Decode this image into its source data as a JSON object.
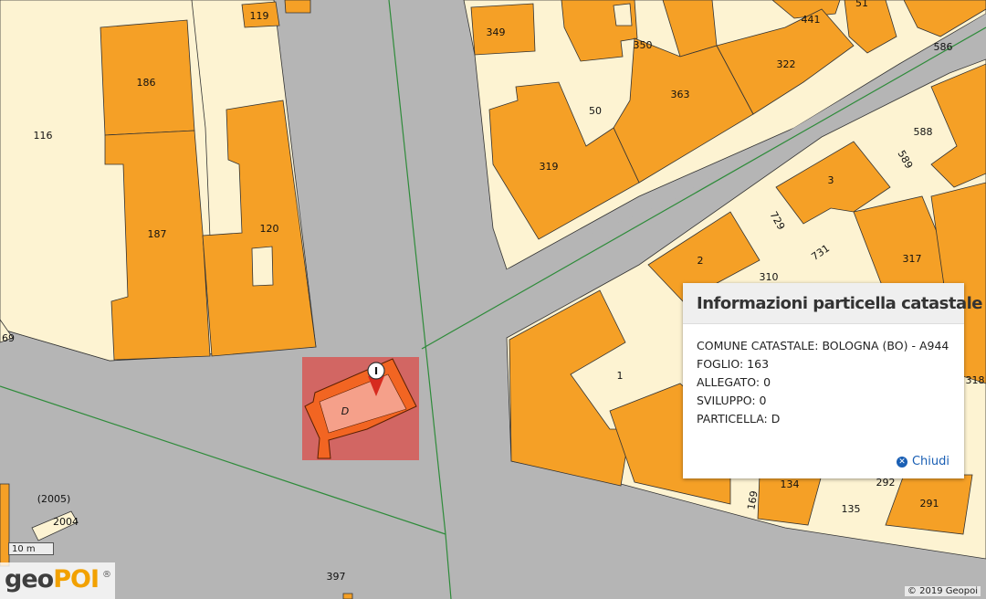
{
  "map": {
    "parcels": [
      "116",
      "119",
      "120",
      "186",
      "187",
      "349",
      "350",
      "441",
      "51",
      "586",
      "322",
      "363",
      "50",
      "319",
      "588",
      "589",
      "3",
      "729",
      "731",
      "317",
      "2",
      "310",
      "1",
      "318",
      "134",
      "292",
      "291",
      "135",
      "169",
      "2004",
      "(2005)",
      "397",
      "69"
    ],
    "selected_parcel_label": "D",
    "marker_glyph": "I"
  },
  "scale": {
    "label": "10 m"
  },
  "logo": {
    "text_left": "geo",
    "text_right": "POI",
    "reg": "®"
  },
  "attribution": {
    "text": "© 2019 Geopoi"
  },
  "popup": {
    "title": "Informazioni particella catastale",
    "lines": [
      "COMUNE CATASTALE: BOLOGNA (BO) - A944",
      "FOGLIO: 163",
      "ALLEGATO: 0",
      "SVILUPPO: 0",
      "PARTICELLA: D"
    ],
    "close_label": "Chiudi",
    "close_icon": "close-circle-icon"
  },
  "colors": {
    "building": "#f5a026",
    "parcel": "#fdf3d2",
    "road": "#b5b5b5",
    "boundary": "#2e8b3a",
    "highlight": "#d9534f",
    "selected": "#f26522",
    "link": "#1a5fb4"
  }
}
